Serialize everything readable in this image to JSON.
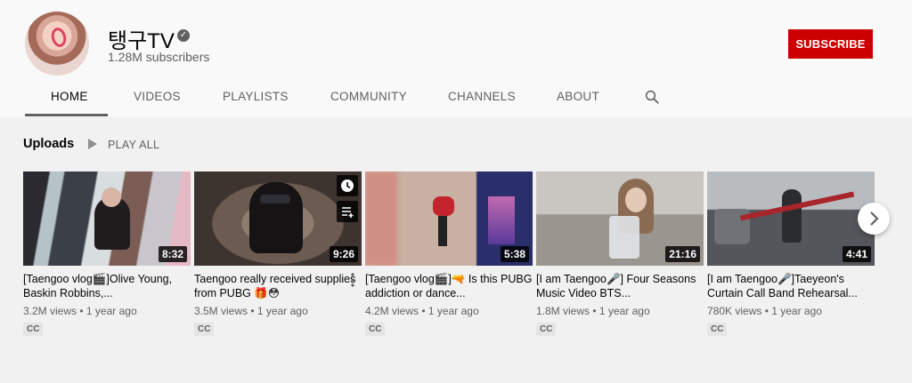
{
  "channel": {
    "name": "탱구TV",
    "subscribers": "1.28M subscribers",
    "subscribe_label": "SUBSCRIBE",
    "verified_icon": "check-badge-icon"
  },
  "tabs": [
    {
      "label": "HOME",
      "active": true
    },
    {
      "label": "VIDEOS"
    },
    {
      "label": "PLAYLISTS"
    },
    {
      "label": "COMMUNITY"
    },
    {
      "label": "CHANNELS"
    },
    {
      "label": "ABOUT"
    }
  ],
  "uploads": {
    "title": "Uploads",
    "play_all_label": "PLAY ALL",
    "videos": [
      {
        "title": "[Taengoo vlog🎬]Olive Young, Baskin Robbins,...",
        "duration": "8:32",
        "views": "3.2M views",
        "age": "1 year ago",
        "badge": "CC"
      },
      {
        "title": "Taengoo really received supplies from PUBG 🎁😳",
        "duration": "9:26",
        "views": "3.5M views",
        "age": "1 year ago",
        "badge": "CC"
      },
      {
        "title": "[Taengoo vlog🎬]🔫 Is this PUBG addiction or dance...",
        "duration": "5:38",
        "views": "4.2M views",
        "age": "1 year ago",
        "badge": "CC"
      },
      {
        "title": "[I am Taengoo🎤] Four Seasons Music Video BTS...",
        "duration": "21:16",
        "views": "1.8M views",
        "age": "1 year ago",
        "badge": "CC"
      },
      {
        "title": "[I am Taengoo🎤]Taeyeon's Curtain Call Band Rehearsal...",
        "duration": "4:41",
        "views": "780K views",
        "age": "1 year ago",
        "badge": "CC"
      }
    ]
  },
  "colors": {
    "subscribe": "#cc0000",
    "background": "#f1f1f1",
    "header": "#f9f9f9"
  }
}
